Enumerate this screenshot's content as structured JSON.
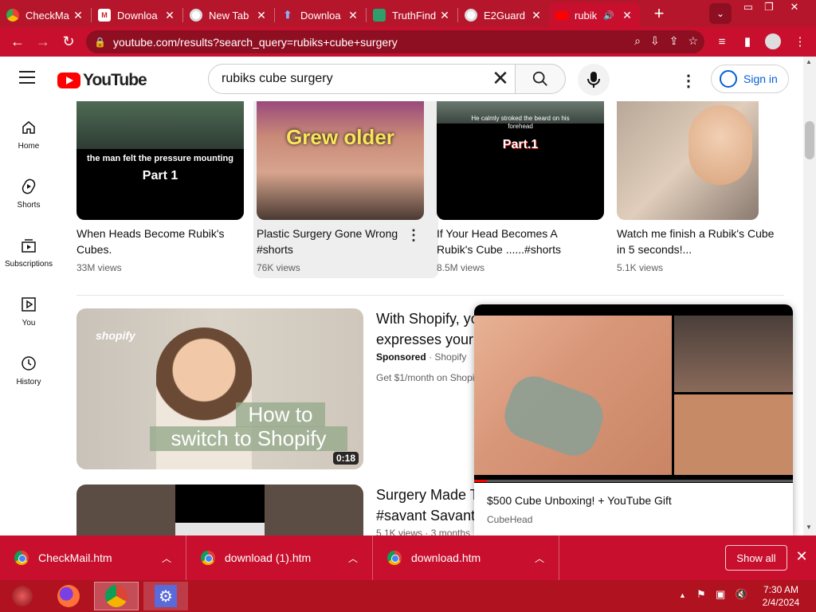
{
  "browser": {
    "tabs": [
      {
        "label": "CheckMa",
        "favicon": "chrome-icon"
      },
      {
        "label": "Downloa",
        "favicon": "gmail-icon"
      },
      {
        "label": "New Tab",
        "favicon": "chrome-icon"
      },
      {
        "label": "Downloa",
        "favicon": "upload-icon"
      },
      {
        "label": "TruthFind",
        "favicon": "truthfinder-icon"
      },
      {
        "label": "E2Guard",
        "favicon": "chrome-icon"
      },
      {
        "label": "rubik",
        "favicon": "youtube-icon",
        "active": true
      }
    ],
    "url": "youtube.com/results?search_query=rubiks+cube+surgery",
    "accent_color": "#c8102e"
  },
  "youtube": {
    "logo_text": "YouTube",
    "search_value": "rubiks cube surgery",
    "signin_label": "Sign in",
    "guide": [
      {
        "label": "Home",
        "icon": "home-icon"
      },
      {
        "label": "Shorts",
        "icon": "shorts-icon"
      },
      {
        "label": "Subscriptions",
        "icon": "subscriptions-icon"
      },
      {
        "label": "You",
        "icon": "you-icon"
      },
      {
        "label": "History",
        "icon": "history-icon"
      }
    ],
    "shorts": [
      {
        "title": "When Heads Become Rubik's Cubes.",
        "views": "33M views",
        "caption1": "the man felt the pressure mounting",
        "caption2": "Part 1"
      },
      {
        "title": "Plastic Surgery Gone Wrong #shorts",
        "views": "76K views",
        "caption1": "Grew older"
      },
      {
        "title": "If Your Head Becomes A Rubik's Cube ......#shorts",
        "views": "8.5M views",
        "caption1": "He calmly stroked the beard on his forehead",
        "caption2": "Part.1"
      },
      {
        "title": "Watch me finish a Rubik's Cube in 5 seconds!...",
        "views": "5.1K views"
      }
    ],
    "ad": {
      "title_line1": "With Shopify, yo",
      "title_line2": "expresses your",
      "sponsored": "Sponsored",
      "sponsor": "Shopify",
      "desc": "Get $1/month on Shopi",
      "thumb_brand": "shopify",
      "thumb_text1": "How to",
      "thumb_text2": "switch to Shopify",
      "duration": "0:18"
    },
    "video2": {
      "title_line1": "Surgery Made T",
      "title_line2": "#savant Savant",
      "meta": "5.1K views · 3 months"
    },
    "miniplayer": {
      "title": "$500 Cube Unboxing! + YouTube Gift",
      "channel": "CubeHead"
    }
  },
  "downloads": {
    "items": [
      "CheckMail.htm",
      "download (1).htm",
      "download.htm"
    ],
    "show_all": "Show all"
  },
  "taskbar": {
    "time": "7:30 AM",
    "date": "2/4/2024"
  }
}
